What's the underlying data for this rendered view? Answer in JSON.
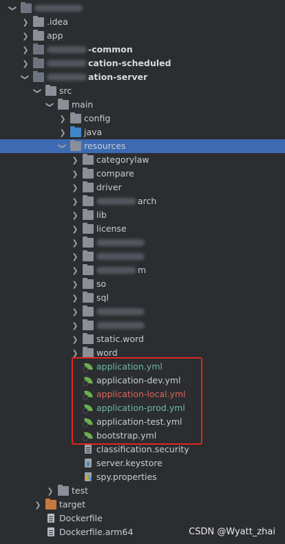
{
  "project_tree": {
    "rows": [
      {
        "depth": 0,
        "expand": "open",
        "icon": "module-folder-icon",
        "label": "",
        "redacted": true,
        "style": "bold"
      },
      {
        "depth": 1,
        "expand": "closed",
        "icon": "folder-icon",
        "label": ".idea",
        "style": ""
      },
      {
        "depth": 1,
        "expand": "closed",
        "icon": "folder-icon",
        "label": "app",
        "style": ""
      },
      {
        "depth": 1,
        "expand": "closed",
        "icon": "module-folder-icon",
        "label": "-common",
        "redacted": true,
        "style": "bold"
      },
      {
        "depth": 1,
        "expand": "closed",
        "icon": "module-folder-icon",
        "label": "cation-scheduled",
        "redacted": true,
        "style": "bold"
      },
      {
        "depth": 1,
        "expand": "open",
        "icon": "module-folder-icon",
        "label": "ation-server",
        "redacted": true,
        "style": "bold"
      },
      {
        "depth": 2,
        "expand": "open",
        "icon": "folder-icon",
        "label": "src",
        "style": ""
      },
      {
        "depth": 3,
        "expand": "open",
        "icon": "folder-icon",
        "label": "main",
        "style": ""
      },
      {
        "depth": 4,
        "expand": "closed",
        "icon": "folder-icon",
        "label": "config",
        "style": ""
      },
      {
        "depth": 4,
        "expand": "closed",
        "icon": "source-folder-icon",
        "label": "java",
        "style": ""
      },
      {
        "depth": 4,
        "expand": "open",
        "icon": "resources-folder-icon",
        "label": "resources",
        "style": "",
        "selected": true
      },
      {
        "depth": 5,
        "expand": "closed",
        "icon": "folder-icon",
        "label": "categorylaw",
        "style": ""
      },
      {
        "depth": 5,
        "expand": "closed",
        "icon": "folder-icon",
        "label": "compare",
        "style": ""
      },
      {
        "depth": 5,
        "expand": "closed",
        "icon": "folder-icon",
        "label": "driver",
        "style": ""
      },
      {
        "depth": 5,
        "expand": "closed",
        "icon": "folder-icon",
        "label": "arch",
        "redacted": true,
        "style": ""
      },
      {
        "depth": 5,
        "expand": "closed",
        "icon": "folder-icon",
        "label": "lib",
        "style": ""
      },
      {
        "depth": 5,
        "expand": "closed",
        "icon": "folder-icon",
        "label": "license",
        "style": ""
      },
      {
        "depth": 5,
        "expand": "closed",
        "icon": "folder-icon",
        "label": "",
        "redacted": true,
        "style": ""
      },
      {
        "depth": 5,
        "expand": "closed",
        "icon": "folder-icon",
        "label": "",
        "redacted": true,
        "style": ""
      },
      {
        "depth": 5,
        "expand": "closed",
        "icon": "folder-icon",
        "label": "m",
        "redacted": true,
        "style": ""
      },
      {
        "depth": 5,
        "expand": "closed",
        "icon": "folder-icon",
        "label": "so",
        "style": ""
      },
      {
        "depth": 5,
        "expand": "closed",
        "icon": "folder-icon",
        "label": "sql",
        "style": ""
      },
      {
        "depth": 5,
        "expand": "closed",
        "icon": "folder-icon",
        "label": "",
        "redacted": true,
        "style": ""
      },
      {
        "depth": 5,
        "expand": "closed",
        "icon": "folder-icon",
        "label": "",
        "redacted": true,
        "style": ""
      },
      {
        "depth": 5,
        "expand": "closed",
        "icon": "folder-icon",
        "label": "static.word",
        "style": ""
      },
      {
        "depth": 5,
        "expand": "closed",
        "icon": "folder-icon",
        "label": "word",
        "style": ""
      },
      {
        "depth": 5,
        "expand": "none",
        "icon": "yml-spring-icon",
        "label": "application.yml",
        "style": "green"
      },
      {
        "depth": 5,
        "expand": "none",
        "icon": "yml-spring-icon",
        "label": "application-dev.yml",
        "style": ""
      },
      {
        "depth": 5,
        "expand": "none",
        "icon": "yml-spring-icon",
        "label": "application-local.yml",
        "style": "red"
      },
      {
        "depth": 5,
        "expand": "none",
        "icon": "yml-spring-icon",
        "label": "application-prod.yml",
        "style": "green"
      },
      {
        "depth": 5,
        "expand": "none",
        "icon": "yml-spring-icon",
        "label": "application-test.yml",
        "style": ""
      },
      {
        "depth": 5,
        "expand": "none",
        "icon": "yml-spring-icon",
        "label": "bootstrap.yml",
        "style": ""
      },
      {
        "depth": 5,
        "expand": "none",
        "icon": "text-file-icon",
        "label": "classification.security",
        "style": ""
      },
      {
        "depth": 5,
        "expand": "none",
        "icon": "keystore-file-icon",
        "label": "server.keystore",
        "style": ""
      },
      {
        "depth": 5,
        "expand": "none",
        "icon": "properties-file-icon",
        "label": "spy.properties",
        "style": ""
      },
      {
        "depth": 3,
        "expand": "closed",
        "icon": "folder-icon",
        "label": "test",
        "style": ""
      },
      {
        "depth": 2,
        "expand": "closed",
        "icon": "excluded-folder-icon",
        "label": "target",
        "style": ""
      },
      {
        "depth": 2,
        "expand": "none",
        "icon": "docker-file-icon",
        "label": "Dockerfile",
        "style": ""
      },
      {
        "depth": 2,
        "expand": "none",
        "icon": "docker-file-icon",
        "label": "Dockerfile.arm64",
        "style": ""
      }
    ]
  },
  "watermark": "CSDN @Wyatt_zhai"
}
